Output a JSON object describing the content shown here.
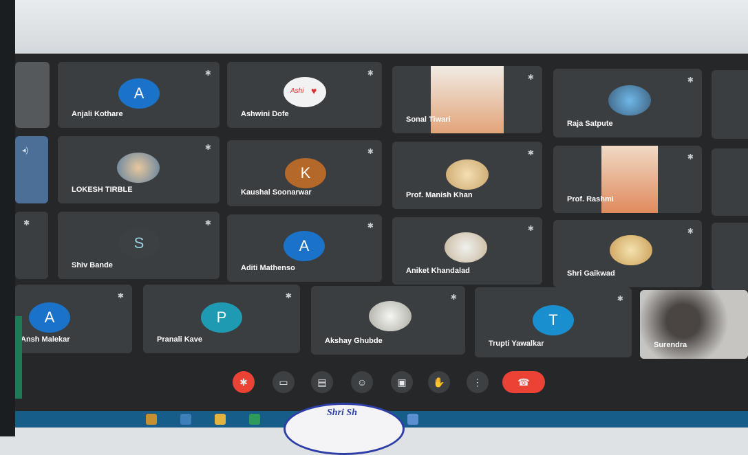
{
  "meeting": {
    "participants": [
      {
        "name": "Anjali Kothare",
        "initial": "A",
        "type": "initial",
        "color": "#1a73c9"
      },
      {
        "name": "Ashwini Dofe",
        "type": "photo"
      },
      {
        "name": "Sonal Tiwari",
        "type": "video"
      },
      {
        "name": "Raja Satpute",
        "type": "photo"
      },
      {
        "name": "LOKESH TIRBLE",
        "type": "photo"
      },
      {
        "name": "Kaushal Soonarwar",
        "initial": "K",
        "type": "initial",
        "color": "#b4682a"
      },
      {
        "name": "Prof. Manish Khan",
        "type": "photo"
      },
      {
        "name": "Prof. Rashmi",
        "type": "video"
      },
      {
        "name": "Shiv Bande",
        "initial": "S",
        "type": "initial",
        "color": "#3c4043"
      },
      {
        "name": "Aditi Mathenso",
        "initial": "A",
        "type": "initial",
        "color": "#1a73c9"
      },
      {
        "name": "Aniket Khandalad",
        "type": "photo"
      },
      {
        "name": "Shri Gaikwad",
        "type": "photo"
      },
      {
        "name": "Ansh Malekar",
        "initial": "A",
        "type": "initial",
        "color": "#1a73c9"
      },
      {
        "name": "Pranali Kave",
        "initial": "P",
        "type": "initial",
        "color": "#1e9bb3"
      },
      {
        "name": "Akshay Ghubde",
        "type": "photo"
      },
      {
        "name": "Trupti Yawalkar",
        "initial": "T",
        "type": "initial",
        "color": "#1a8fd0"
      },
      {
        "name": "Surendra",
        "type": "video"
      }
    ],
    "photo_caption": "Ashi"
  },
  "controls": [
    {
      "name": "mic-off-button",
      "icon": "mic-off-icon"
    },
    {
      "name": "camera-button",
      "icon": "camera-icon"
    },
    {
      "name": "captions-button",
      "icon": "captions-icon"
    },
    {
      "name": "emoji-button",
      "icon": "emoji-icon"
    },
    {
      "name": "present-button",
      "icon": "present-icon"
    },
    {
      "name": "raise-hand-button",
      "icon": "hand-icon"
    },
    {
      "name": "more-options-button",
      "icon": "more-vert-icon"
    },
    {
      "name": "leave-call-button",
      "icon": "call-end-icon"
    }
  ],
  "stamp": {
    "text": "Shri Sh"
  },
  "colors": {
    "tile": "#3b3e41",
    "background": "#252729",
    "leave": "#ea4335",
    "taskbar": "#175d8a"
  }
}
